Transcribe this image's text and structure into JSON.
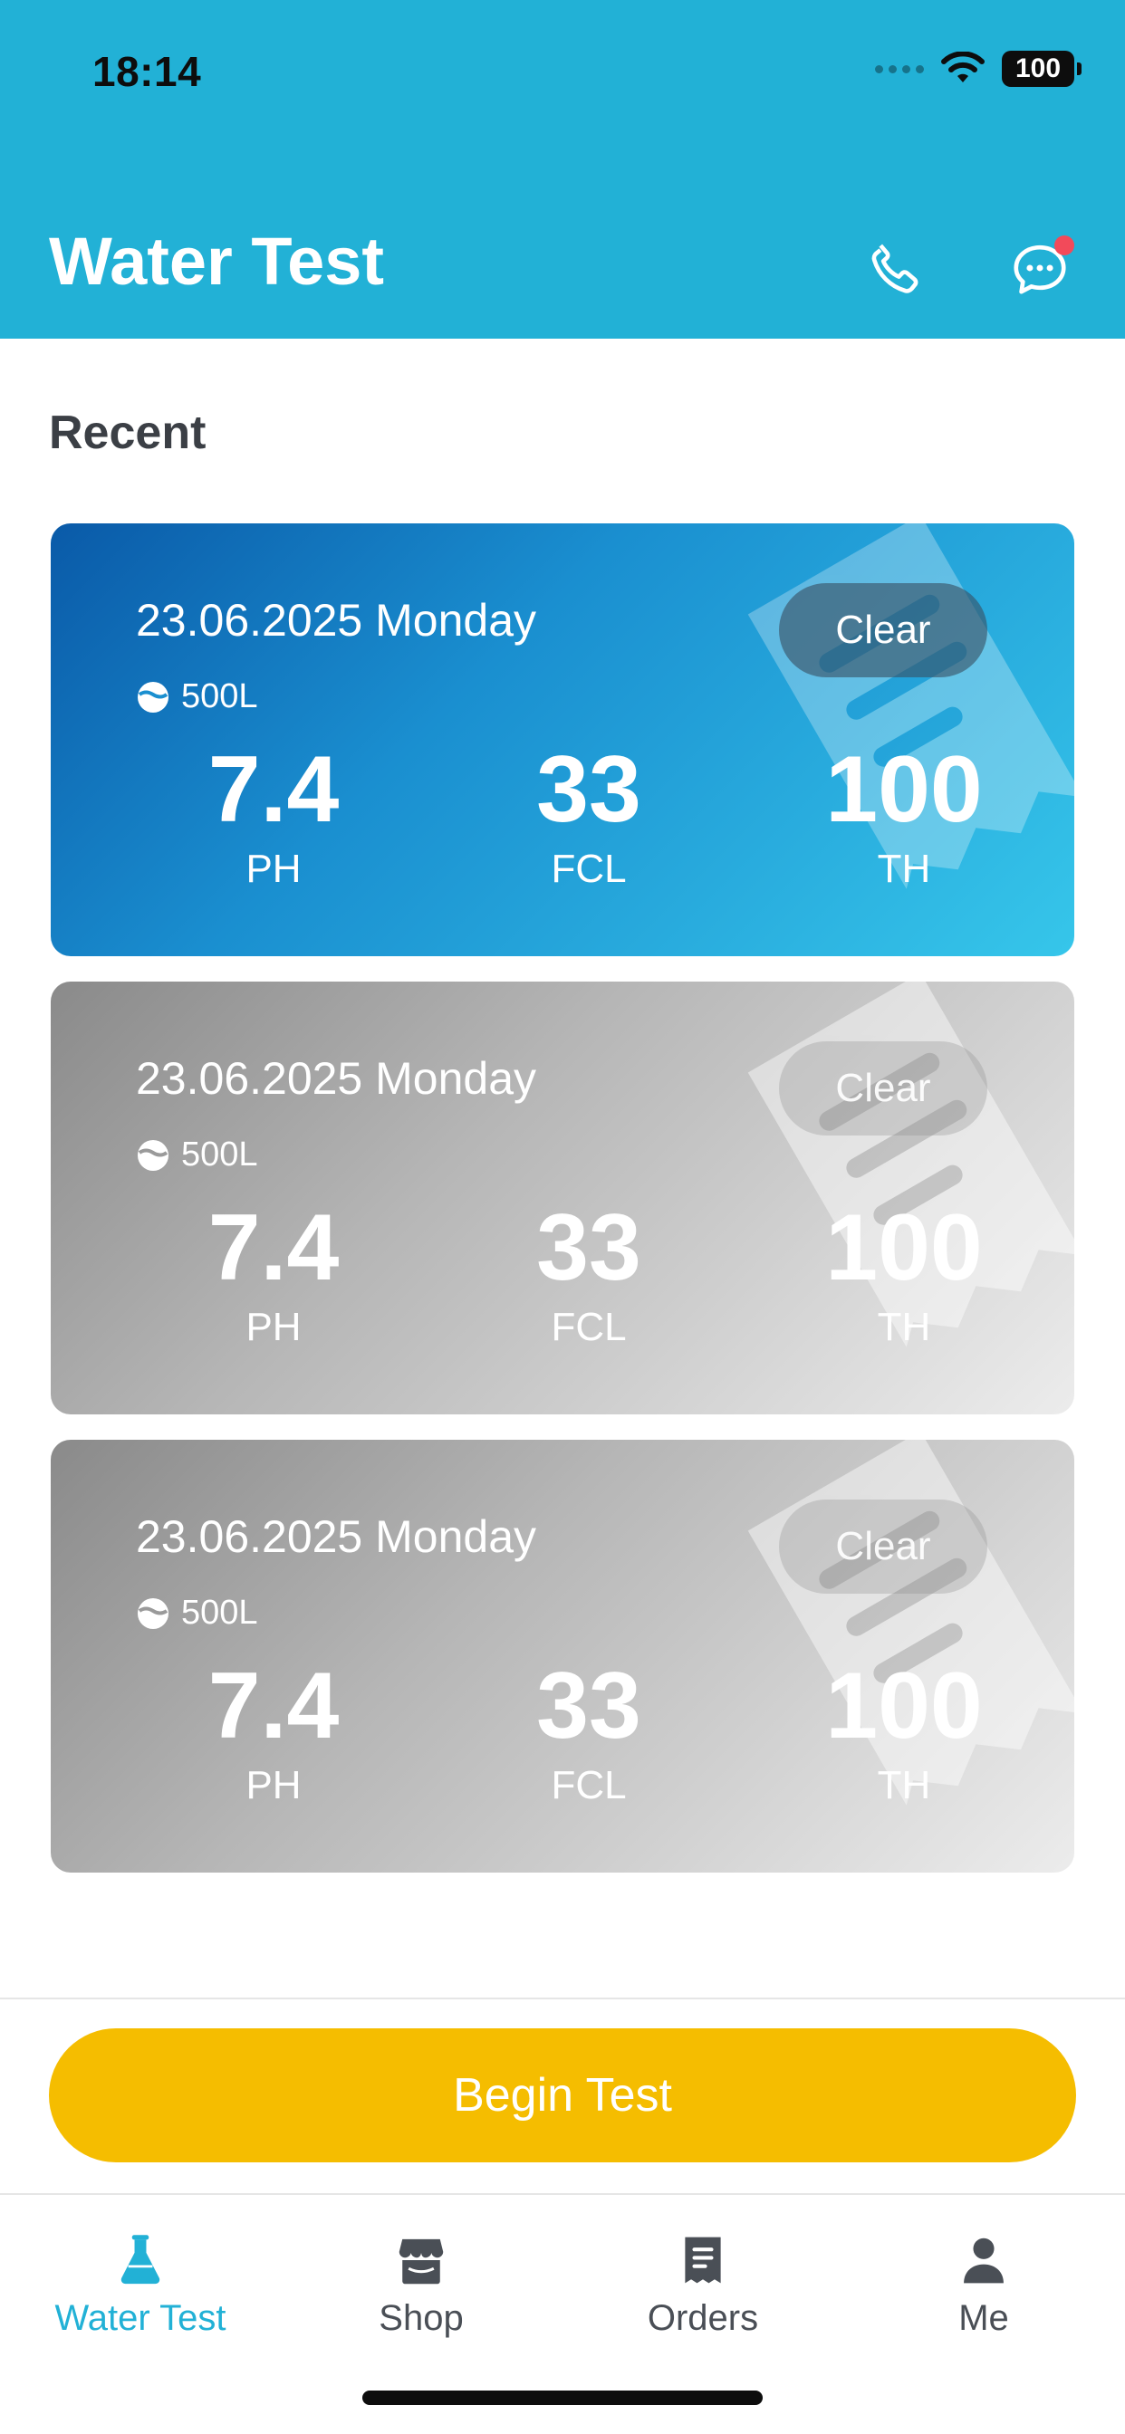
{
  "status_bar": {
    "time": "18:14",
    "battery": "100"
  },
  "header": {
    "title": "Water Test"
  },
  "recent": {
    "title": "Recent",
    "cards": [
      {
        "date": "23.06.2025 Monday",
        "volume": "500L",
        "clear_label": "Clear",
        "metrics": [
          {
            "value": "7.4",
            "label": "PH"
          },
          {
            "value": "33",
            "label": "FCL"
          },
          {
            "value": "100",
            "label": "TH"
          }
        ]
      },
      {
        "date": "23.06.2025 Monday",
        "volume": "500L",
        "clear_label": "Clear",
        "metrics": [
          {
            "value": "7.4",
            "label": "PH"
          },
          {
            "value": "33",
            "label": "FCL"
          },
          {
            "value": "100",
            "label": "TH"
          }
        ]
      },
      {
        "date": "23.06.2025 Monday",
        "volume": "500L",
        "clear_label": "Clear",
        "metrics": [
          {
            "value": "7.4",
            "label": "PH"
          },
          {
            "value": "33",
            "label": "FCL"
          },
          {
            "value": "100",
            "label": "TH"
          }
        ]
      }
    ]
  },
  "begin_button": {
    "label": "Begin Test"
  },
  "tabs": [
    {
      "label": "Water Test",
      "icon": "flask-icon",
      "active": true
    },
    {
      "label": "Shop",
      "icon": "shop-icon",
      "active": false
    },
    {
      "label": "Orders",
      "icon": "orders-icon",
      "active": false
    },
    {
      "label": "Me",
      "icon": "person-icon",
      "active": false
    }
  ],
  "colors": {
    "accent": "#22b1d6",
    "button": "#f5bd00",
    "notification": "#f24a5a"
  }
}
